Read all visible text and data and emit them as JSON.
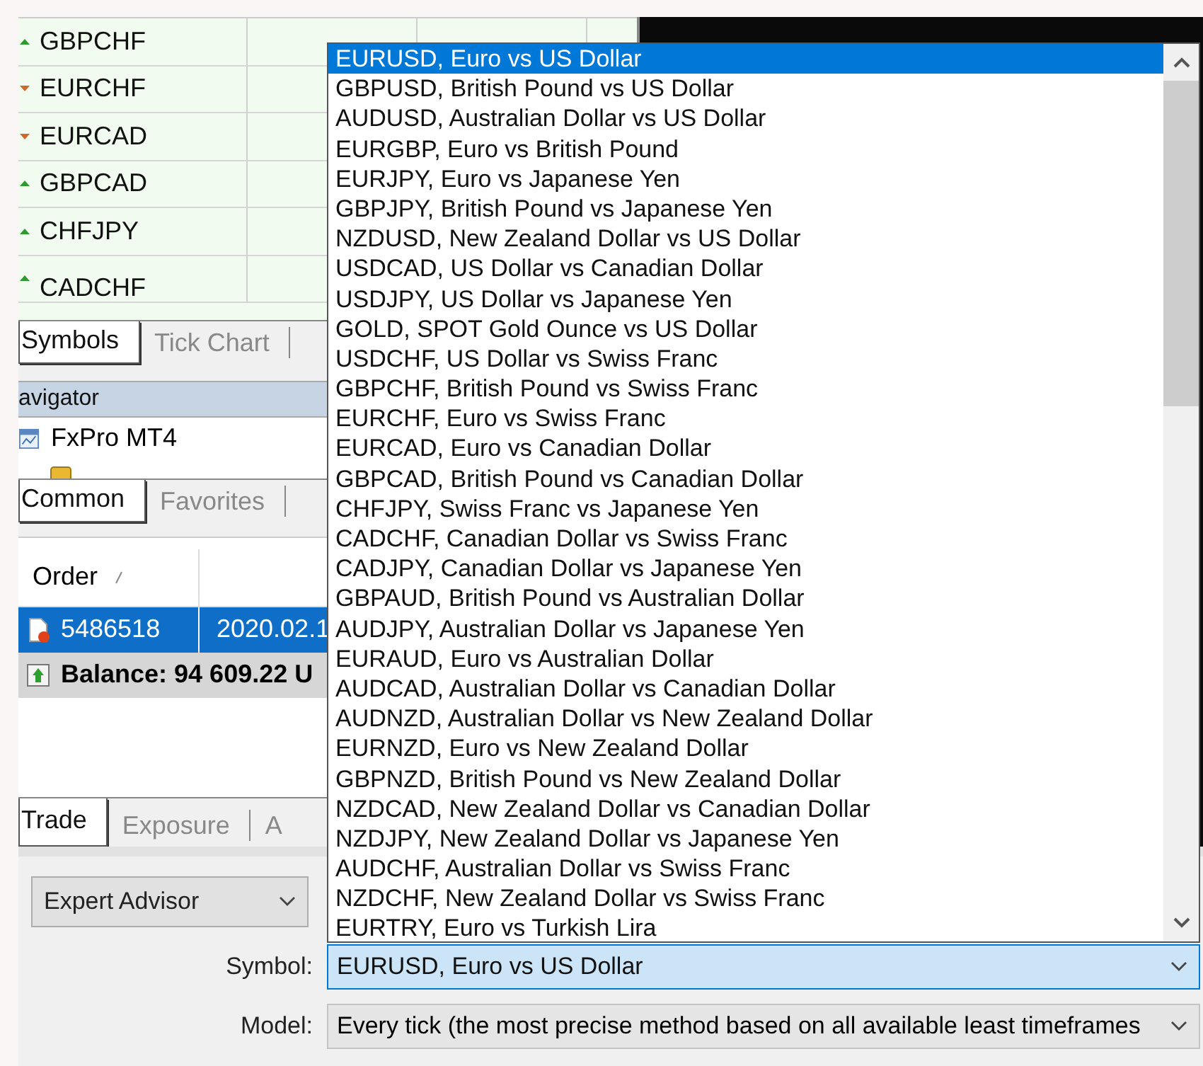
{
  "market_watch": {
    "rows": [
      {
        "symbol": "GBPCHF",
        "rising": true
      },
      {
        "symbol": "EURCHF",
        "rising": false
      },
      {
        "symbol": "EURCAD",
        "rising": false
      },
      {
        "symbol": "GBPCAD",
        "rising": true
      },
      {
        "symbol": "CHFJPY",
        "rising": true
      },
      {
        "symbol": "CADCHF",
        "rising": true
      }
    ]
  },
  "market_watch_tabs": [
    {
      "label": "Symbols",
      "selected": true
    },
    {
      "label": "Tick Chart",
      "selected": false
    }
  ],
  "navigator": {
    "title": "avigator",
    "items": [
      {
        "label": "FxPro MT4"
      }
    ]
  },
  "navigator_tabs": [
    {
      "label": "Common",
      "selected": true
    },
    {
      "label": "Favorites",
      "selected": false
    }
  ],
  "orders": {
    "columns": [
      "Order"
    ],
    "rows": [
      {
        "kind": "order",
        "selected": true,
        "cells": [
          "5486518",
          "2020.02.1"
        ]
      },
      {
        "kind": "balance",
        "selected": false,
        "cells": [
          "Balance: 94 609.22 U"
        ]
      }
    ]
  },
  "terminal_tabs": [
    {
      "label": "Trade",
      "selected": true
    },
    {
      "label": "Exposure",
      "selected": false
    },
    {
      "label": "A",
      "selected": false
    }
  ],
  "tester": {
    "mode": "Expert Advisor",
    "symbol_label": "Symbol:",
    "symbol": "EURUSD, Euro vs US Dollar",
    "model_label": "Model:",
    "model": "Every tick (the most precise method based on all available least timeframes"
  },
  "symbol_list": {
    "items": [
      {
        "label": "EURUSD, Euro vs US Dollar",
        "selected": true
      },
      {
        "label": "GBPUSD, British Pound vs US Dollar",
        "selected": false
      },
      {
        "label": "AUDUSD, Australian Dollar vs US Dollar",
        "selected": false
      },
      {
        "label": "EURGBP, Euro vs British Pound",
        "selected": false
      },
      {
        "label": "EURJPY, Euro vs Japanese Yen",
        "selected": false
      },
      {
        "label": "GBPJPY, British Pound vs Japanese Yen",
        "selected": false
      },
      {
        "label": "NZDUSD, New Zealand Dollar vs US Dollar",
        "selected": false
      },
      {
        "label": "USDCAD, US Dollar vs Canadian Dollar",
        "selected": false
      },
      {
        "label": "USDJPY, US Dollar vs Japanese Yen",
        "selected": false
      },
      {
        "label": "GOLD, SPOT Gold Ounce vs US Dollar",
        "selected": false
      },
      {
        "label": "USDCHF, US Dollar vs Swiss Franc",
        "selected": false
      },
      {
        "label": "GBPCHF, British Pound vs Swiss Franc",
        "selected": false
      },
      {
        "label": "EURCHF, Euro vs Swiss Franc",
        "selected": false
      },
      {
        "label": "EURCAD, Euro vs Canadian Dollar",
        "selected": false
      },
      {
        "label": "GBPCAD, British Pound vs Canadian Dollar",
        "selected": false
      },
      {
        "label": "CHFJPY, Swiss Franc vs Japanese Yen",
        "selected": false
      },
      {
        "label": "CADCHF, Canadian Dollar vs Swiss Franc",
        "selected": false
      },
      {
        "label": "CADJPY, Canadian Dollar vs Japanese Yen",
        "selected": false
      },
      {
        "label": "GBPAUD, British Pound vs Australian Dollar",
        "selected": false
      },
      {
        "label": "AUDJPY, Australian Dollar vs Japanese Yen",
        "selected": false
      },
      {
        "label": "EURAUD, Euro vs Australian Dollar",
        "selected": false
      },
      {
        "label": "AUDCAD, Australian Dollar vs Canadian Dollar",
        "selected": false
      },
      {
        "label": "AUDNZD, Australian Dollar vs New Zealand Dollar",
        "selected": false
      },
      {
        "label": "EURNZD, Euro vs New Zealand Dollar",
        "selected": false
      },
      {
        "label": "GBPNZD, British Pound vs New Zealand Dollar",
        "selected": false
      },
      {
        "label": "NZDCAD, New Zealand Dollar vs Canadian Dollar",
        "selected": false
      },
      {
        "label": "NZDJPY, New Zealand Dollar vs Japanese Yen",
        "selected": false
      },
      {
        "label": "AUDCHF, Australian Dollar vs Swiss Franc",
        "selected": false
      },
      {
        "label": "NZDCHF, New Zealand Dollar vs Swiss Franc",
        "selected": false
      },
      {
        "label": "EURTRY, Euro vs Turkish Lira",
        "selected": false
      }
    ]
  }
}
